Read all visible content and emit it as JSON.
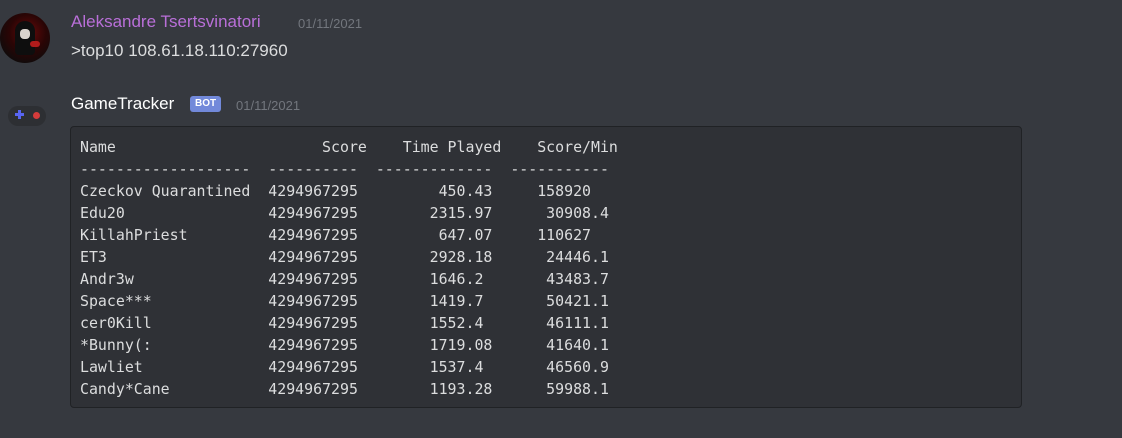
{
  "messages": [
    {
      "author": "Aleksandre Tsertsvinatori",
      "author_color": "#b96fd8",
      "timestamp": "01/11/2021",
      "content": ">top10 108.61.18.110:27960"
    },
    {
      "author": "GameTracker",
      "author_color": "#ffffff",
      "badge": "BOT",
      "timestamp": "01/11/2021",
      "code_block": {
        "header": "Name                       Score    Time Played    Score/Min",
        "separator": "-------------------  ----------  -------------  -----------",
        "rows": [
          "Czeckov Quarantined  4294967295         450.43     158920",
          "Edu20                4294967295        2315.97      30908.4",
          "KillahPriest         4294967295         647.07     110627",
          "ET3                  4294967295        2928.18      24446.1",
          "Andr3w               4294967295        1646.2       43483.7",
          "Space***             4294967295        1419.7       50421.1",
          "cer0Kill             4294967295        1552.4       46111.1",
          "*Bunny(:             4294967295        1719.08      41640.1",
          "Lawliet              4294967295        1537.4       46560.9",
          "Candy*Cane           4294967295        1193.28      59988.1"
        ]
      }
    }
  ]
}
